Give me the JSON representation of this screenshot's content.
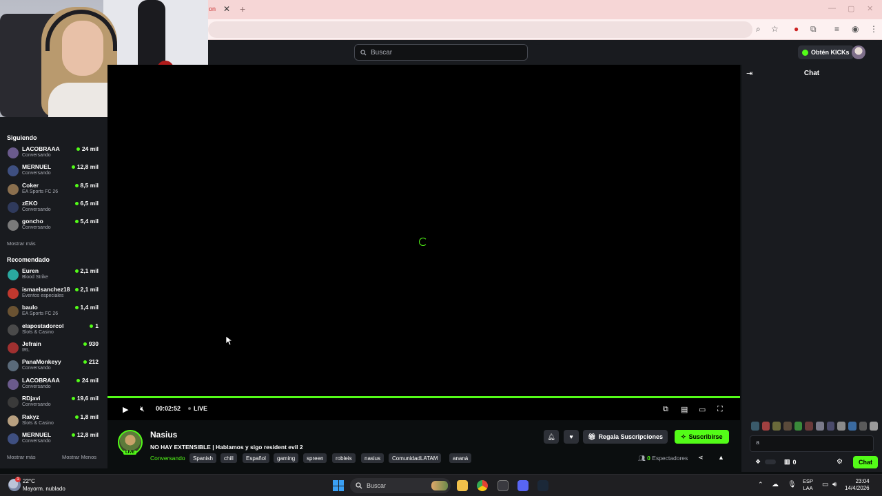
{
  "browser": {
    "tab_fragment": "on",
    "tab_close": "✕",
    "new_tab": "+"
  },
  "header": {
    "search_placeholder": "Buscar",
    "kicks_label": "Obtén KICKs"
  },
  "sidebar": {
    "following_title": "Siguiendo",
    "following": [
      {
        "name": "LACOBRAAA",
        "category": "Conversando",
        "viewers": "24 mil",
        "avatar_color": "#6a5a8c"
      },
      {
        "name": "MERNUEL",
        "category": "Conversando",
        "viewers": "12,8 mil",
        "avatar_color": "#3e4f80"
      },
      {
        "name": "Coker",
        "category": "EA Sports FC 26",
        "viewers": "8,5 mil",
        "avatar_color": "#8a6f4e"
      },
      {
        "name": "zEKO",
        "category": "Conversando",
        "viewers": "6,5 mil",
        "avatar_color": "#2f3a5c"
      },
      {
        "name": "goncho",
        "category": "Conversando",
        "viewers": "5,4 mil",
        "avatar_color": "#7a7a7a"
      }
    ],
    "show_more_following": "Mostrar más",
    "recommended_title": "Recomendado",
    "recommended": [
      {
        "name": "Euren",
        "category": "Blood Strike",
        "viewers": "2,1 mil",
        "avatar_color": "#2aa8a0"
      },
      {
        "name": "ismaelsanchez18",
        "category": "Eventos especiales",
        "viewers": "2,1 mil",
        "avatar_color": "#c0382e"
      },
      {
        "name": "baulo",
        "category": "EA Sports FC 26",
        "viewers": "1,4 mil",
        "avatar_color": "#6a5232"
      },
      {
        "name": "elapostadorcol",
        "category": "Slots & Casino",
        "viewers": "1",
        "avatar_color": "#4a4a4a"
      },
      {
        "name": "Jefrain",
        "category": "IRL",
        "viewers": "930",
        "avatar_color": "#a03030"
      },
      {
        "name": "PanaMonkeyy",
        "category": "Conversando",
        "viewers": "212",
        "avatar_color": "#5a6a7a"
      },
      {
        "name": "LACOBRAAA",
        "category": "Conversando",
        "viewers": "24 mil",
        "avatar_color": "#6a5a8c"
      },
      {
        "name": "RDjavi",
        "category": "Conversando",
        "viewers": "19,6 mil",
        "avatar_color": "#3a3a3a"
      },
      {
        "name": "Rakyz",
        "category": "Slots & Casino",
        "viewers": "1,8 mil",
        "avatar_color": "#b8a080"
      },
      {
        "name": "MERNUEL",
        "category": "Conversando",
        "viewers": "12,8 mil",
        "avatar_color": "#3e4f80"
      }
    ],
    "show_more": "Mostrar más",
    "show_less": "Mostrar Menos"
  },
  "player": {
    "time": "00:02:52",
    "live": "LIVE",
    "progress": 1.0
  },
  "stream": {
    "streamer": "Nasius",
    "live_badge": "LIVE",
    "title": "NO HAY EXTENSIBLE | Hablamos y sigo resident evil 2",
    "category": "Conversando",
    "tags": [
      "Spanish",
      "chill",
      "Español",
      "gaming",
      "spreen",
      "robleis",
      "nasius",
      "ComunidadLATAM",
      "ananá"
    ],
    "gift_label": "Regala Suscripciones",
    "subscribe_label": "Suscribirse",
    "viewers_count": "0",
    "viewers_label": "Espectadores"
  },
  "chat": {
    "title": "Chat",
    "input_placeholder": "a",
    "count": "0",
    "send_label": "Chat",
    "emote_colors": [
      "#3a5a6a",
      "#a04040",
      "#6a6a3a",
      "#5a4a3a",
      "#3a8a3a",
      "#6a3a3a",
      "#7a7a8a",
      "#4a4a6a",
      "#8a8a8a",
      "#3a6aa0",
      "#5a5a5a",
      "#9a9a9a"
    ]
  },
  "taskbar": {
    "temperature": "22°C",
    "weather": "Mayorm. nublado",
    "weather_badge": "1",
    "search_placeholder": "Buscar",
    "lang_top": "ESP",
    "lang_bottom": "LAA",
    "time": "23:04",
    "date": "14/4/2026"
  },
  "colors": {
    "accent": "#53fc18",
    "panel": "#191b1f",
    "background": "#0b0e0f"
  }
}
